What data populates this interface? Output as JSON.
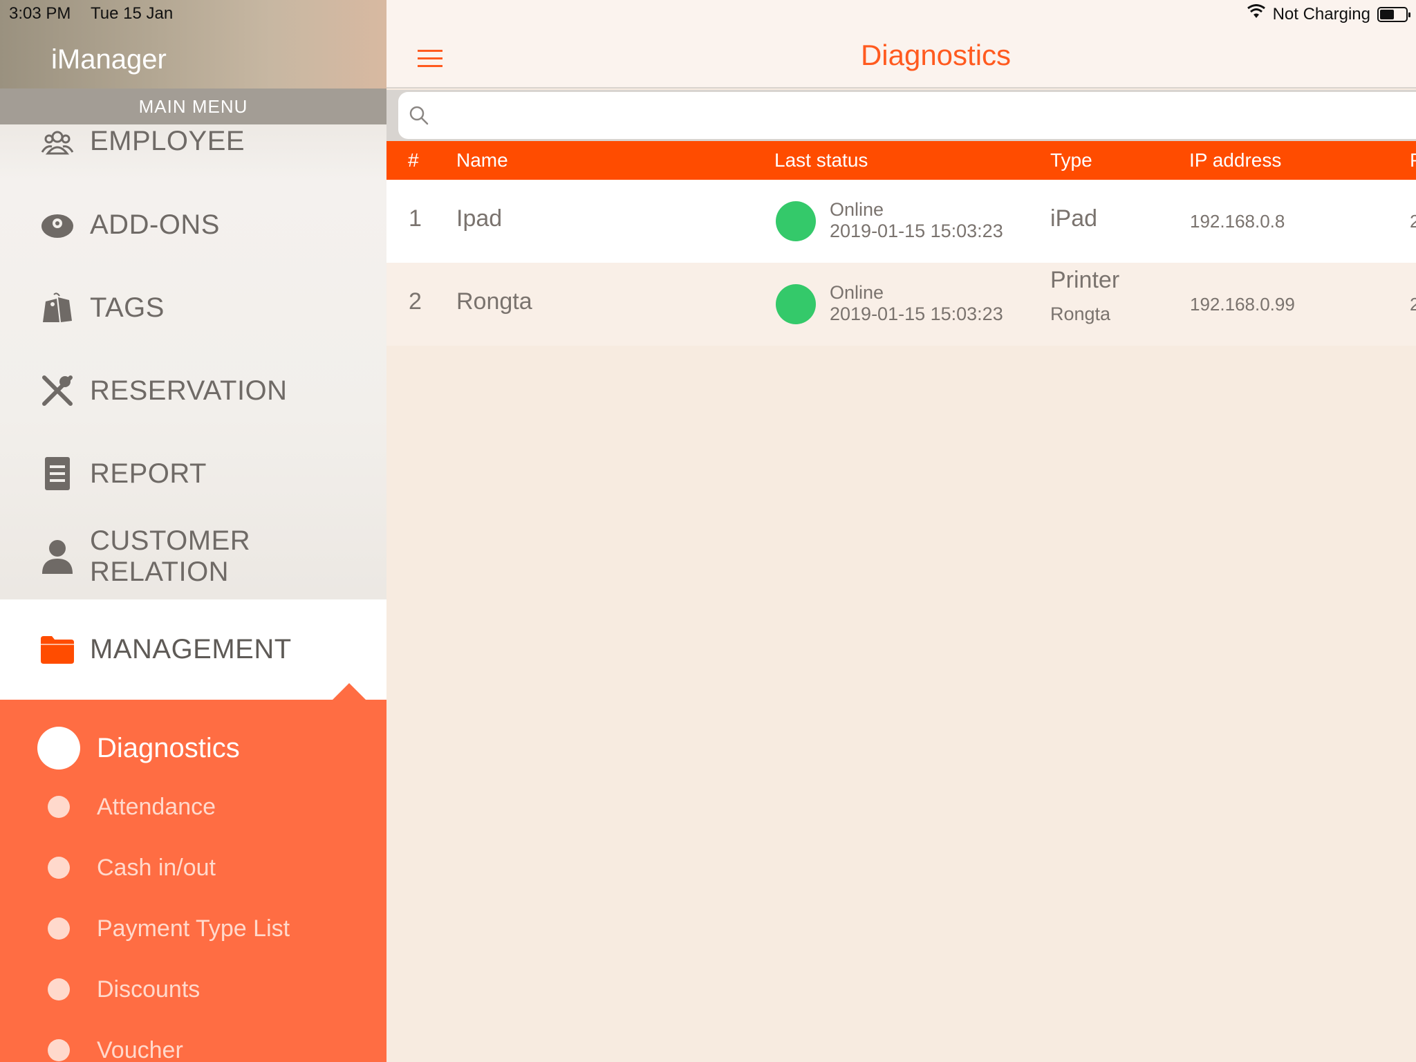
{
  "status_bar": {
    "time": "3:03 PM",
    "date": "Tue 15 Jan",
    "charging": "Not Charging"
  },
  "sidebar": {
    "app_title": "iManager",
    "section_label": "MAIN MENU",
    "items": [
      {
        "label": "EMPLOYEE",
        "icon": "employees-icon"
      },
      {
        "label": "ADD-ONS",
        "icon": "addons-icon"
      },
      {
        "label": "TAGS",
        "icon": "tags-icon"
      },
      {
        "label": "RESERVATION",
        "icon": "fork-knife-icon"
      },
      {
        "label": "REPORT",
        "icon": "document-icon"
      },
      {
        "label": "CUSTOMER RELATION",
        "icon": "person-icon"
      },
      {
        "label": "MANAGEMENT",
        "icon": "folder-icon",
        "active": true
      }
    ],
    "submenu": [
      {
        "label": "Diagnostics",
        "current": true
      },
      {
        "label": "Attendance"
      },
      {
        "label": "Cash in/out"
      },
      {
        "label": "Payment Type List"
      },
      {
        "label": "Discounts"
      },
      {
        "label": "Voucher"
      }
    ]
  },
  "header": {
    "title": "Diagnostics"
  },
  "search": {
    "placeholder": "",
    "value": ""
  },
  "table": {
    "columns": [
      "#",
      "Name",
      "Last status",
      "Type",
      "IP address",
      "P"
    ],
    "rows": [
      {
        "num": "1",
        "name": "Ipad",
        "status": "Online",
        "timestamp": "2019-01-15 15:03:23",
        "type": "iPad",
        "type_sub": "",
        "ip": "192.168.0.8",
        "more": "2"
      },
      {
        "num": "2",
        "name": "Rongta",
        "status": "Online",
        "timestamp": "2019-01-15 15:03:23",
        "type": "Printer",
        "type_sub": "Rongta",
        "ip": "192.168.0.99",
        "more": "2"
      }
    ]
  },
  "colors": {
    "accent": "#ff5a1f",
    "header_bar": "#ff4c00",
    "submenu_bg": "#ff6d43",
    "online": "#34c96a"
  }
}
